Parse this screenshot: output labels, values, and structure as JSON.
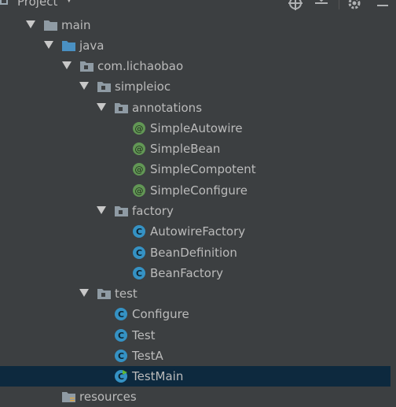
{
  "header": {
    "title": "Project",
    "dropdown_glyph": "▼"
  },
  "tree": [
    {
      "label": "main",
      "icon": "folder-icon",
      "expanded": true
    },
    {
      "label": "java",
      "icon": "source-folder-icon",
      "expanded": true
    },
    {
      "label": "com.lichaobao",
      "icon": "package-icon",
      "expanded": true
    },
    {
      "label": "simpleioc",
      "icon": "package-icon",
      "expanded": true
    },
    {
      "label": "annotations",
      "icon": "package-icon",
      "expanded": true
    },
    {
      "label": "SimpleAutowire",
      "icon": "annotation-icon",
      "badge": "@"
    },
    {
      "label": "SimpleBean",
      "icon": "annotation-icon",
      "badge": "@"
    },
    {
      "label": "SimpleCompotent",
      "icon": "annotation-icon",
      "badge": "@"
    },
    {
      "label": "SimpleConfigure",
      "icon": "annotation-icon",
      "badge": "@"
    },
    {
      "label": "factory",
      "icon": "package-icon",
      "expanded": true
    },
    {
      "label": "AutowireFactory",
      "icon": "class-icon",
      "badge": "C"
    },
    {
      "label": "BeanDefinition",
      "icon": "class-icon",
      "badge": "C"
    },
    {
      "label": "BeanFactory",
      "icon": "class-icon",
      "badge": "C"
    },
    {
      "label": "test",
      "icon": "package-icon",
      "expanded": true
    },
    {
      "label": "Configure",
      "icon": "class-icon",
      "badge": "C"
    },
    {
      "label": "Test",
      "icon": "class-icon",
      "badge": "C"
    },
    {
      "label": "TestA",
      "icon": "class-icon",
      "badge": "C"
    },
    {
      "label": "TestMain",
      "icon": "runnable-class-icon",
      "badge": "C",
      "selected": true
    },
    {
      "label": "resources",
      "icon": "resources-folder-icon"
    }
  ],
  "colors": {
    "background": "#3c3f41",
    "selection": "#0d293e",
    "annotation_badge": "#629755",
    "class_badge": "#3592c4",
    "source_folder": "#4a90c2",
    "folder": "#8f9ba4"
  }
}
